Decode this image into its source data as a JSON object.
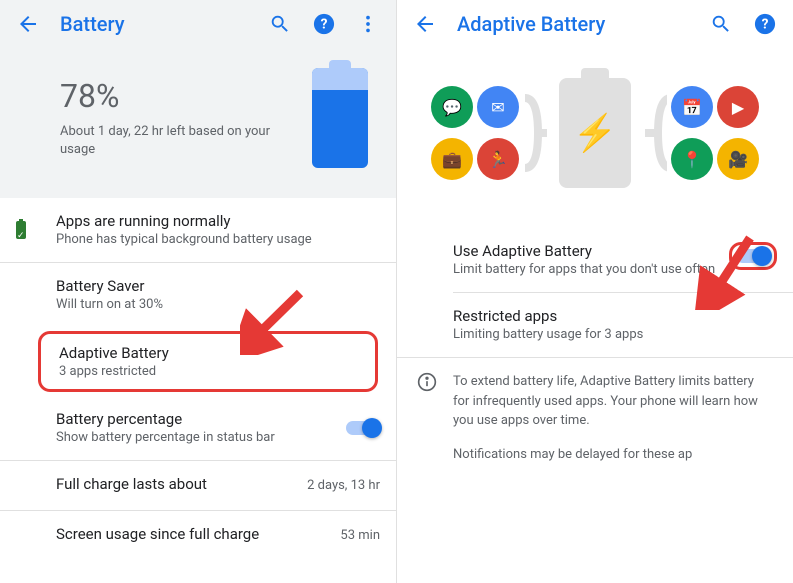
{
  "left": {
    "header": {
      "title": "Battery"
    },
    "hero": {
      "percent": "78%",
      "subtitle": "About 1 day, 22 hr left based on your usage"
    },
    "status": {
      "title": "Apps are running normally",
      "sub": "Phone has typical background battery usage"
    },
    "saver": {
      "title": "Battery Saver",
      "sub": "Will turn on at 30%"
    },
    "adaptive": {
      "title": "Adaptive Battery",
      "sub": "3 apps restricted"
    },
    "pct": {
      "title": "Battery percentage",
      "sub": "Show battery percentage in status bar"
    },
    "full": {
      "title": "Full charge lasts about",
      "val": "2 days, 13 hr"
    },
    "since": {
      "title": "Screen usage since full charge",
      "val": "53 min"
    }
  },
  "right": {
    "header": {
      "title": "Adaptive Battery"
    },
    "use": {
      "title": "Use Adaptive Battery",
      "sub": "Limit battery for apps that you don't use often"
    },
    "restricted": {
      "title": "Restricted apps",
      "sub": "Limiting battery usage for 3 apps"
    },
    "info1": "To extend battery life, Adaptive Battery limits battery for infrequently used apps. Your phone will learn how you use apps over time.",
    "info2": "Notifications may be delayed for these ap"
  }
}
